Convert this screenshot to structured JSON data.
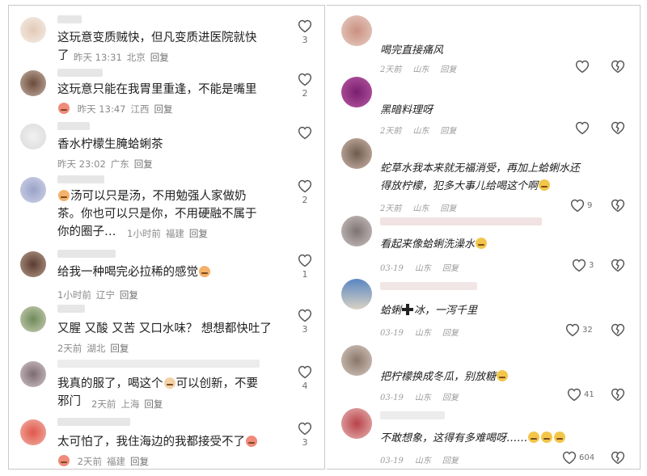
{
  "left_comments": [
    {
      "lines": [
        "这玩意变质贼快，但凡变质进医院就快",
        "了"
      ],
      "meta": {
        "time": "昨天 13:31",
        "loc": "北京",
        "reply": "回复"
      },
      "likes": "3"
    },
    {
      "lines": [
        "这玩意只能在我胃里重逢，不能是嘴里"
      ],
      "meta": {
        "time": "昨天 13:47",
        "loc": "江西",
        "reply": "回复"
      },
      "likes": "2"
    },
    {
      "lines": [
        "香水柠檬生腌蛤蜊茶"
      ],
      "meta": {
        "time": "昨天 23:02",
        "loc": "广东",
        "reply": "回复"
      },
      "likes": ""
    },
    {
      "lines": [
        "汤可以只是汤，不用勉强人家做奶",
        "茶。你也可以只是你，不用硬融不属于",
        "你的圈子…"
      ],
      "meta": {
        "time": "1小时前",
        "loc": "福建",
        "reply": "回复"
      },
      "likes": "2"
    },
    {
      "lines": [
        "给我一种喝完必拉稀的感觉"
      ],
      "meta": {
        "time": "1小时前",
        "loc": "辽宁",
        "reply": "回复"
      },
      "likes": "1"
    },
    {
      "lines": [
        "又腥 又酸 又苦 又口水味？ 想想都快吐了"
      ],
      "meta": {
        "time": "2天前",
        "loc": "湖北",
        "reply": "回复"
      },
      "likes": "3"
    },
    {
      "lines": [
        "我真的服了，喝这个",
        "可以创新，不要",
        "邪门"
      ],
      "meta": {
        "time": "2天前",
        "loc": "上海",
        "reply": "回复"
      },
      "likes": "4"
    },
    {
      "lines": [
        "太可怕了，我住海边的我都接受不了"
      ],
      "meta": {
        "time": "2天前",
        "loc": "福建",
        "reply": "回复"
      },
      "likes": "3"
    }
  ],
  "right_comments": [
    {
      "lines": [
        "喝完直接痛风"
      ],
      "meta": {
        "time": "2天前",
        "loc": "山东",
        "reply": "回复"
      },
      "likes": ""
    },
    {
      "lines": [
        "黑暗料理呀"
      ],
      "meta": {
        "time": "2天前",
        "loc": "山东",
        "reply": "回复"
      },
      "likes": ""
    },
    {
      "lines": [
        "蛇草水我本来就无福消受，再加上蛤蜊水还",
        "得放柠檬，犯多大事儿给喝这个啊"
      ],
      "meta": {
        "time": "2天前",
        "loc": "山东",
        "reply": "回复"
      },
      "likes": "9"
    },
    {
      "lines": [
        "看起来像蛤蜊洗澡水"
      ],
      "meta": {
        "time": "03-19",
        "loc": "山东",
        "reply": "回复"
      },
      "likes": "3"
    },
    {
      "lines": [
        "蛤蜊",
        "冰，一泻千里"
      ],
      "meta": {
        "time": "03-19",
        "loc": "山东",
        "reply": "回复"
      },
      "likes": "32"
    },
    {
      "lines": [
        "把柠檬换成冬瓜，别放糖"
      ],
      "meta": {
        "time": "03-19",
        "loc": "山东",
        "reply": "回复"
      },
      "likes": "41"
    },
    {
      "lines": [
        "不敢想象，这得有多难喝呀……"
      ],
      "meta": {
        "time": "03-19",
        "loc": "山东",
        "reply": "回复"
      },
      "likes": "604"
    }
  ],
  "colors": {
    "text": "#1e1e1e",
    "meta": "#8a8a8a",
    "border": "#c9c9c9",
    "icon": "#555555"
  }
}
